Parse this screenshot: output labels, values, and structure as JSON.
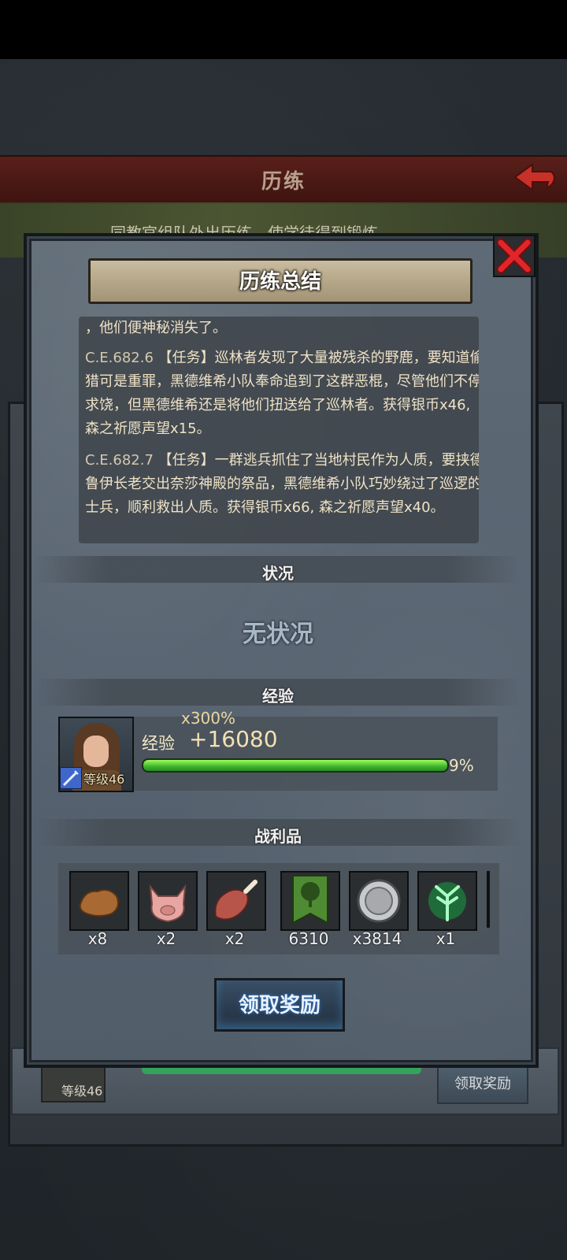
{
  "background": {
    "header_title": "历练",
    "strip_text": "同教官组队外出历练，使学徒得到锻炼",
    "behind_level": "等级46",
    "behind_claim_label": "领取奖励"
  },
  "dialog": {
    "title": "历练总结",
    "log": [
      {
        "date": "",
        "text": "，他们便神秘消失了。"
      },
      {
        "date": "C.E.682.6",
        "text": "【任务】巡林者发现了大量被残杀的野鹿，要知道偷猎可是重罪，黑德维希小队奉命追到了这群恶棍，尽管他们不停求饶，但黑德维希还是将他们扭送给了巡林者。获得银币x46, 森之祈愿声望x15。"
      },
      {
        "date": "C.E.682.7",
        "text": "【任务】一群逃兵抓住了当地村民作为人质，要挟德鲁伊长老交出奈莎神殿的祭品，黑德维希小队巧妙绕过了巡逻的士兵，顺利救出人质。获得银币x66, 森之祈愿声望x40。"
      }
    ],
    "status_section_label": "状况",
    "status_value": "无状况",
    "exp_section_label": "经验",
    "avatar_level": "等级46",
    "multiplier": "x300%",
    "exp_label": "经验",
    "exp_gain": "+16080",
    "exp_progress_percent": 9,
    "exp_progress_label": "9%",
    "loot_section_label": "战利品",
    "loot": [
      {
        "icon": "leather-hide-icon",
        "count": "x8"
      },
      {
        "icon": "pig-head-icon",
        "count": "x2"
      },
      {
        "icon": "ham-leg-icon",
        "count": "x2"
      },
      {
        "icon": "tree-banner-icon",
        "count": "6310"
      },
      {
        "icon": "silver-coin-icon",
        "count": "x3814"
      },
      {
        "icon": "green-tree-spirit-icon",
        "count": "x1"
      }
    ],
    "claim_label": "领取奖励"
  },
  "colors": {
    "accent_green": "#3fb32e",
    "header_red": "#5a1f1a",
    "close_red": "#d21f1f"
  }
}
